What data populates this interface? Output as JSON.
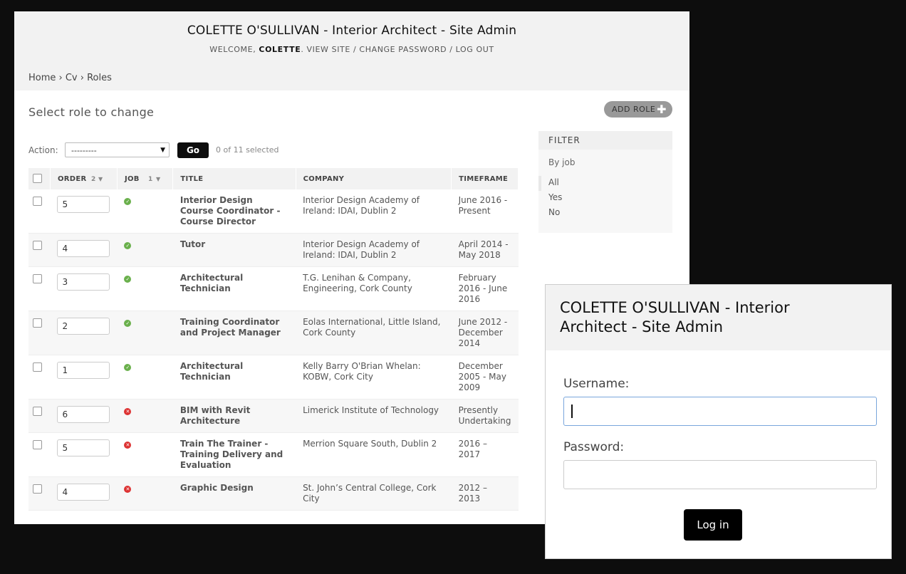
{
  "admin": {
    "site_title": "COLETTE O'SULLIVAN - Interior Architect - Site Admin",
    "user_tools": {
      "welcome": "WELCOME, ",
      "username": "COLETTE",
      "sep_dot": ". ",
      "view_site": "VIEW SITE",
      "sep1": " / ",
      "change_password": "CHANGE PASSWORD",
      "sep2": " / ",
      "log_out": "LOG OUT"
    },
    "breadcrumbs": {
      "home": "Home",
      "sep1": " › ",
      "cv": "Cv",
      "sep2": " › ",
      "current": "Roles"
    },
    "heading": "Select role to change",
    "add_button": "ADD ROLE",
    "actions": {
      "label": "Action:",
      "selected_value": "---------",
      "go": "Go",
      "count": "0 of 11 selected"
    },
    "columns": {
      "order": "ORDER",
      "order_sort": "2",
      "job": "JOB",
      "job_sort": "1",
      "title": "TITLE",
      "company": "COMPANY",
      "timeframe": "TIMEFRAME"
    },
    "rows": [
      {
        "order": "5",
        "job": "yes",
        "title": "Interior Design Course Coordinator - Course Director",
        "company": "Interior Design Academy of Ireland: IDAI, Dublin 2",
        "timeframe": "June 2016 - Present"
      },
      {
        "order": "4",
        "job": "yes",
        "title": "Tutor",
        "company": "Interior Design Academy of Ireland: IDAI, Dublin 2",
        "timeframe": "April 2014 - May 2018"
      },
      {
        "order": "3",
        "job": "yes",
        "title": "Architectural Technician",
        "company": "T.G. Lenihan & Company, Engineering, Cork County",
        "timeframe": "February 2016 - June 2016"
      },
      {
        "order": "2",
        "job": "yes",
        "title": "Training Coordinator and Project Manager",
        "company": "Eolas International, Little Island, Cork County",
        "timeframe": "June 2012 - December 2014"
      },
      {
        "order": "1",
        "job": "yes",
        "title": "Architectural Technician",
        "company": "Kelly Barry O'Brian Whelan: KOBW, Cork City",
        "timeframe": "December 2005 - May 2009"
      },
      {
        "order": "6",
        "job": "no",
        "title": "BIM with Revit Architecture",
        "company": "Limerick Institute of Technology",
        "timeframe": "Presently Undertaking"
      },
      {
        "order": "5",
        "job": "no",
        "title": "Train The Trainer - Training Delivery and Evaluation",
        "company": "Merrion Square South, Dublin 2",
        "timeframe": "2016 – 2017"
      },
      {
        "order": "4",
        "job": "no",
        "title": "Graphic Design",
        "company": "St. John’s Central College, Cork City",
        "timeframe": "2012 – 2013"
      }
    ],
    "filter": {
      "header": "FILTER",
      "by": "By job",
      "options": [
        "All",
        "Yes",
        "No"
      ],
      "selected": "All"
    }
  },
  "login": {
    "title": "COLETTE O'SULLIVAN - Interior Architect - Site Admin",
    "username_label": "Username:",
    "username_value": "",
    "password_label": "Password:",
    "password_value": "",
    "button": "Log in"
  },
  "colors": {
    "job_yes": "#6ab04c",
    "job_no": "#dd3333",
    "focus_border": "#79a6dc"
  }
}
